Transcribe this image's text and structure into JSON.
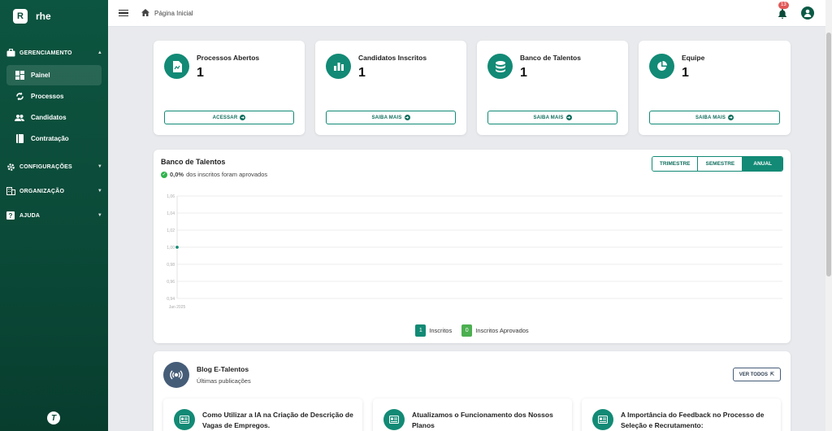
{
  "app": {
    "logo_letter": "R",
    "name": "rhe"
  },
  "sidebar": {
    "sections": [
      {
        "label": "GERENCIAMENTO",
        "icon": "briefcase-icon"
      },
      {
        "label": "CONFIGURAÇÕES",
        "icon": "gear-icon"
      },
      {
        "label": "ORGANIZAÇÃO",
        "icon": "building-icon"
      },
      {
        "label": "AJUDA",
        "icon": "help-icon"
      }
    ],
    "items": [
      {
        "label": "Painel",
        "icon": "dashboard-icon"
      },
      {
        "label": "Processos",
        "icon": "cycle-icon"
      },
      {
        "label": "Candidatos",
        "icon": "people-icon"
      },
      {
        "label": "Contratação",
        "icon": "book-icon"
      }
    ],
    "footer_logo": "T"
  },
  "topbar": {
    "breadcrumb": "Página Inicial",
    "notifications": "13"
  },
  "stats": [
    {
      "title": "Processos Abertos",
      "value": "1",
      "button": "ACESSAR",
      "icon": "document-icon"
    },
    {
      "title": "Candidatos Inscritos",
      "value": "1",
      "button": "SAIBA MAIS",
      "icon": "bar-chart-icon"
    },
    {
      "title": "Banco de Talentos",
      "value": "1",
      "button": "SAIBA MAIS",
      "icon": "database-icon"
    },
    {
      "title": "Equipe",
      "value": "1",
      "button": "SAIBA MAIS",
      "icon": "pie-chart-icon"
    }
  ],
  "chart_panel": {
    "title": "Banco de Talentos",
    "subtitle_value": "0,0%",
    "subtitle_text": "dos inscritos foram aprovados",
    "periods": [
      "TRIMESTRE",
      "SEMESTRE",
      "ANUAL"
    ],
    "active_period": "ANUAL",
    "legend": [
      {
        "count": "1",
        "label": "Inscritos",
        "color": "#128a75"
      },
      {
        "count": "0",
        "label": "Inscritos Aprovados",
        "color": "#4caf50"
      }
    ]
  },
  "chart_data": {
    "type": "line",
    "x": [
      "Jan 2025"
    ],
    "series": [
      {
        "values": [
          1.0
        ]
      }
    ],
    "yticks": [
      "1,06",
      "1,04",
      "1,02",
      "1,00",
      "0,98",
      "0,96",
      "0,94"
    ],
    "ylim": [
      0.94,
      1.06
    ],
    "grid": true
  },
  "blog": {
    "title": "Blog E-Talentos",
    "subtitle": "Últimas publicações",
    "view_all": "VER TODOS",
    "posts": [
      {
        "title": "Como Utilizar a IA na Criação de Descrição de Vagas de Empregos."
      },
      {
        "title": "Atualizamos o Funcionamento dos Nossos Planos"
      },
      {
        "title": "A Importância do Feedback no Processo de Seleção e Recrutamento:"
      }
    ]
  }
}
